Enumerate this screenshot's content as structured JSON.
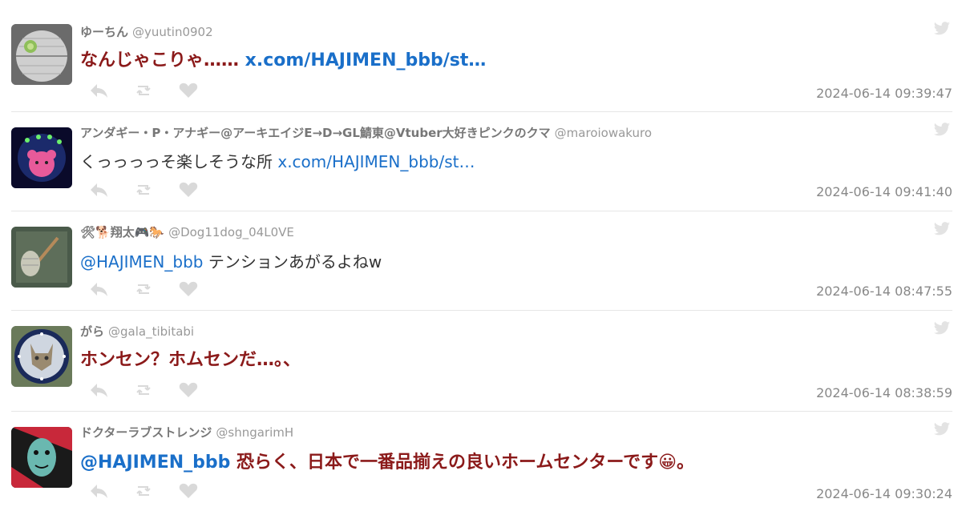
{
  "tweets": [
    {
      "name": "ゆーちん",
      "handle": "@yuutin0902",
      "text_prefix": "なんじゃこりゃ…… ",
      "link": "x.com/HAJIMEN_bbb/st…",
      "text_suffix": "",
      "style": "big",
      "timestamp": "2024-06-14 09:39:47",
      "avatar": "death-star"
    },
    {
      "name": "アンダギー・P・アナギー@アーキエイジE→D→GL鯖東@Vtuber大好きピンクのクマ",
      "handle": "@maroiowakuro",
      "text_prefix": "くっっっっそ楽しそうな所 ",
      "link": "x.com/HAJIMEN_bbb/st…",
      "text_suffix": "",
      "style": "normal",
      "timestamp": "2024-06-14 09:41:40",
      "avatar": "pink-bear"
    },
    {
      "name": "🛠🐕翔太🎮🐎",
      "handle": "@Dog11dog_04L0VE",
      "text_prefix": "",
      "link": "@HAJIMEN_bbb",
      "text_suffix": " テンションあがるよねw",
      "style": "normal",
      "timestamp": "2024-06-14 08:47:55",
      "avatar": "mop"
    },
    {
      "name": "がら",
      "handle": "@gala_tibitabi",
      "text_prefix": "ホンセン？ホムセンだ…。、",
      "link": "",
      "text_suffix": "",
      "style": "big",
      "timestamp": "2024-06-14 08:38:59",
      "avatar": "cat-clock"
    },
    {
      "name": "ドクターラブストレンジ",
      "handle": "@shngarimH",
      "text_prefix": "",
      "link": "@HAJIMEN_bbb",
      "text_suffix": " 恐らく、日本で一番品揃えの良いホームセンターです😀。",
      "style": "big",
      "timestamp": "2024-06-14 09:30:24",
      "avatar": "comic-face"
    }
  ],
  "icons": {
    "reply": "reply-icon",
    "retweet": "retweet-icon",
    "like": "heart-icon",
    "brand": "twitter-bird-icon"
  },
  "colors": {
    "emphasis_text": "#8b1a1a",
    "link": "#1a6fc9",
    "meta": "#888888",
    "icon": "#d9d9d9"
  }
}
